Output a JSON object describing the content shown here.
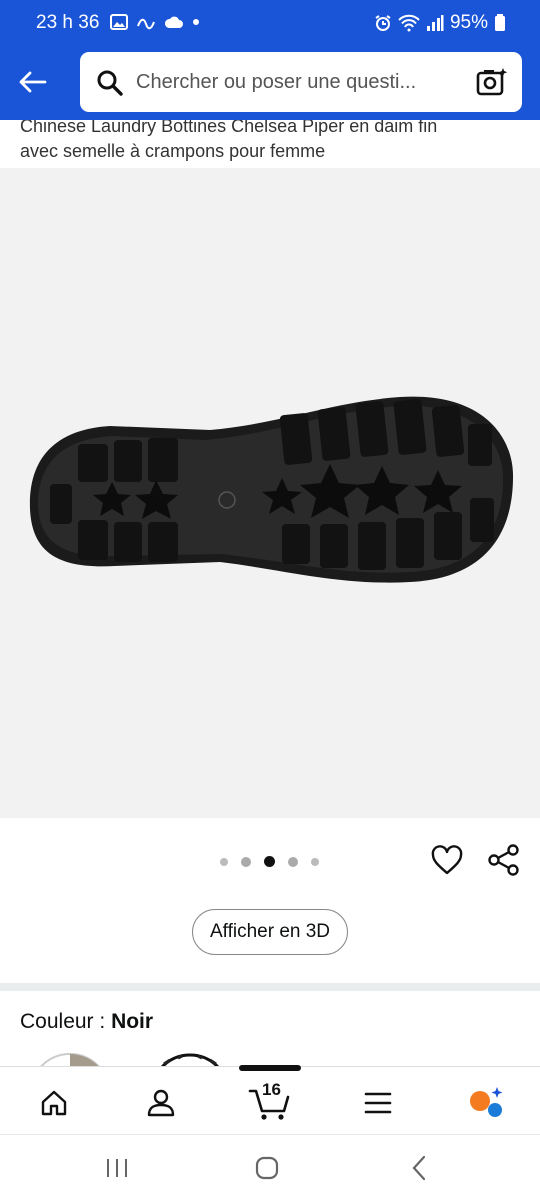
{
  "status_bar": {
    "time": "23 h 36",
    "battery": "95%"
  },
  "search": {
    "placeholder": "Chercher ou poser une questi..."
  },
  "product": {
    "title_line1": "Chinese Laundry Bottines Chelsea Piper en daim fin",
    "title_line2": "avec semelle à crampons pour femme"
  },
  "carousel": {
    "count": 5,
    "active_index": 2
  },
  "buttons": {
    "view_3d": "Afficher en 3D"
  },
  "color": {
    "label": "Couleur :",
    "value": "Noir"
  },
  "nav": {
    "cart_count": "16"
  },
  "colors": {
    "header_blue": "#1a55d8",
    "sole_black": "#1b1b1b"
  }
}
